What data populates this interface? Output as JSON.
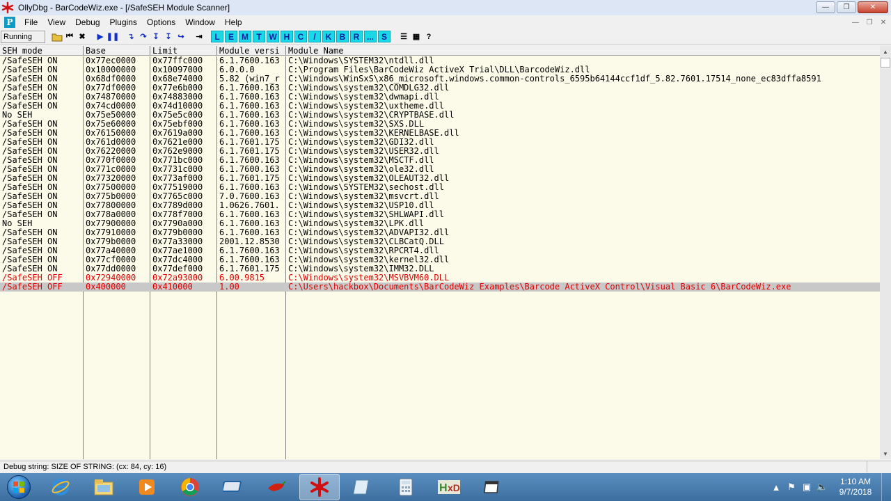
{
  "window": {
    "title": "OllyDbg - BarCodeWiz.exe - [/SafeSEH Module Scanner]",
    "controls": [
      "minimize",
      "maximize",
      "close"
    ]
  },
  "menu": {
    "items": [
      "File",
      "View",
      "Debug",
      "Plugins",
      "Options",
      "Window",
      "Help"
    ]
  },
  "toolbar": {
    "status": "Running",
    "letters": [
      "L",
      "E",
      "M",
      "T",
      "W",
      "H",
      "C",
      "/",
      "K",
      "B",
      "R",
      "...",
      "S"
    ]
  },
  "table": {
    "columns": [
      "SEH mode",
      "Base",
      "Limit",
      "Module versi",
      "Module Name"
    ],
    "rows": [
      {
        "seh": "/SafeSEH ON",
        "base": "0x77ec0000",
        "limit": "0x77ffc000",
        "version": "6.1.7600.163",
        "name": "C:\\Windows\\SYSTEM32\\ntdll.dll",
        "red": false
      },
      {
        "seh": "/SafeSEH ON",
        "base": "0x10000000",
        "limit": "0x10097000",
        "version": "6.0.0.0",
        "name": "C:\\Program Files\\BarCodeWiz ActiveX Trial\\DLL\\BarcodeWiz.dll",
        "red": false
      },
      {
        "seh": "/SafeSEH ON",
        "base": "0x68df0000",
        "limit": "0x68e74000",
        "version": "5.82 (win7_r",
        "name": "C:\\Windows\\WinSxS\\x86_microsoft.windows.common-controls_6595b64144ccf1df_5.82.7601.17514_none_ec83dffa8591",
        "red": false
      },
      {
        "seh": "/SafeSEH ON",
        "base": "0x77df0000",
        "limit": "0x77e6b000",
        "version": "6.1.7600.163",
        "name": "C:\\Windows\\system32\\COMDLG32.dll",
        "red": false
      },
      {
        "seh": "/SafeSEH ON",
        "base": "0x74870000",
        "limit": "0x74883000",
        "version": "6.1.7600.163",
        "name": "C:\\Windows\\system32\\dwmapi.dll",
        "red": false
      },
      {
        "seh": "/SafeSEH ON",
        "base": "0x74cd0000",
        "limit": "0x74d10000",
        "version": "6.1.7600.163",
        "name": "C:\\Windows\\system32\\uxtheme.dll",
        "red": false
      },
      {
        "seh": "No SEH",
        "base": "0x75e50000",
        "limit": "0x75e5c000",
        "version": "6.1.7600.163",
        "name": "C:\\Windows\\system32\\CRYPTBASE.dll",
        "red": false
      },
      {
        "seh": "/SafeSEH ON",
        "base": "0x75e60000",
        "limit": "0x75ebf000",
        "version": "6.1.7600.163",
        "name": "C:\\Windows\\system32\\SXS.DLL",
        "red": false
      },
      {
        "seh": "/SafeSEH ON",
        "base": "0x76150000",
        "limit": "0x7619a000",
        "version": "6.1.7600.163",
        "name": "C:\\Windows\\system32\\KERNELBASE.dll",
        "red": false
      },
      {
        "seh": "/SafeSEH ON",
        "base": "0x761d0000",
        "limit": "0x7621e000",
        "version": "6.1.7601.175",
        "name": "C:\\Windows\\system32\\GDI32.dll",
        "red": false
      },
      {
        "seh": "/SafeSEH ON",
        "base": "0x76220000",
        "limit": "0x762e9000",
        "version": "6.1.7601.175",
        "name": "C:\\Windows\\system32\\USER32.dll",
        "red": false
      },
      {
        "seh": "/SafeSEH ON",
        "base": "0x770f0000",
        "limit": "0x771bc000",
        "version": "6.1.7600.163",
        "name": "C:\\Windows\\system32\\MSCTF.dll",
        "red": false
      },
      {
        "seh": "/SafeSEH ON",
        "base": "0x771c0000",
        "limit": "0x7731c000",
        "version": "6.1.7600.163",
        "name": "C:\\Windows\\system32\\ole32.dll",
        "red": false
      },
      {
        "seh": "/SafeSEH ON",
        "base": "0x77320000",
        "limit": "0x773af000",
        "version": "6.1.7601.175",
        "name": "C:\\Windows\\system32\\OLEAUT32.dll",
        "red": false
      },
      {
        "seh": "/SafeSEH ON",
        "base": "0x77500000",
        "limit": "0x77519000",
        "version": "6.1.7600.163",
        "name": "C:\\Windows\\SYSTEM32\\sechost.dll",
        "red": false
      },
      {
        "seh": "/SafeSEH ON",
        "base": "0x775b0000",
        "limit": "0x7765c000",
        "version": "7.0.7600.163",
        "name": "C:\\Windows\\system32\\msvcrt.dll",
        "red": false
      },
      {
        "seh": "/SafeSEH ON",
        "base": "0x77800000",
        "limit": "0x7789d000",
        "version": "1.0626.7601.",
        "name": "C:\\Windows\\system32\\USP10.dll",
        "red": false
      },
      {
        "seh": "/SafeSEH ON",
        "base": "0x778a0000",
        "limit": "0x778f7000",
        "version": "6.1.7600.163",
        "name": "C:\\Windows\\system32\\SHLWAPI.dll",
        "red": false
      },
      {
        "seh": "No SEH",
        "base": "0x77900000",
        "limit": "0x7790a000",
        "version": "6.1.7600.163",
        "name": "C:\\Windows\\system32\\LPK.dll",
        "red": false
      },
      {
        "seh": "/SafeSEH ON",
        "base": "0x77910000",
        "limit": "0x779b0000",
        "version": "6.1.7600.163",
        "name": "C:\\Windows\\system32\\ADVAPI32.dll",
        "red": false
      },
      {
        "seh": "/SafeSEH ON",
        "base": "0x779b0000",
        "limit": "0x77a33000",
        "version": "2001.12.8530",
        "name": "C:\\Windows\\system32\\CLBCatQ.DLL",
        "red": false
      },
      {
        "seh": "/SafeSEH ON",
        "base": "0x77a40000",
        "limit": "0x77ae1000",
        "version": "6.1.7600.163",
        "name": "C:\\Windows\\system32\\RPCRT4.dll",
        "red": false
      },
      {
        "seh": "/SafeSEH ON",
        "base": "0x77cf0000",
        "limit": "0x77dc4000",
        "version": "6.1.7600.163",
        "name": "C:\\Windows\\system32\\kernel32.dll",
        "red": false
      },
      {
        "seh": "/SafeSEH ON",
        "base": "0x77dd0000",
        "limit": "0x77def000",
        "version": "6.1.7601.175",
        "name": "C:\\Windows\\system32\\IMM32.DLL",
        "red": false
      },
      {
        "seh": "/SafeSEH OFF",
        "base": "0x72940000",
        "limit": "0x72a93000",
        "version": "6.00.9815",
        "name": "C:\\Windows\\system32\\MSVBVM60.DLL",
        "red": true
      },
      {
        "seh": "/SafeSEH OFF",
        "base": "0x400000",
        "limit": "0x410000",
        "version": "1.00",
        "name": "C:\\Users\\hackbox\\Documents\\BarCodeWiz Examples\\Barcode ActiveX Control\\Visual Basic 6\\BarCodeWiz.exe",
        "red": true,
        "selected": true
      }
    ]
  },
  "statusbar": {
    "message": "Debug string:  SIZE OF STRING: (cx: 84, cy: 16)"
  },
  "taskbar": {
    "clock_time": "1:10 AM",
    "clock_date": "9/7/2018",
    "apps": [
      "internet-explorer",
      "file-explorer",
      "media-player",
      "chrome",
      "remote-desktop",
      "chili-app",
      "ollydbg",
      "notepad-app",
      "calculator",
      "hxd",
      "window-app"
    ]
  }
}
